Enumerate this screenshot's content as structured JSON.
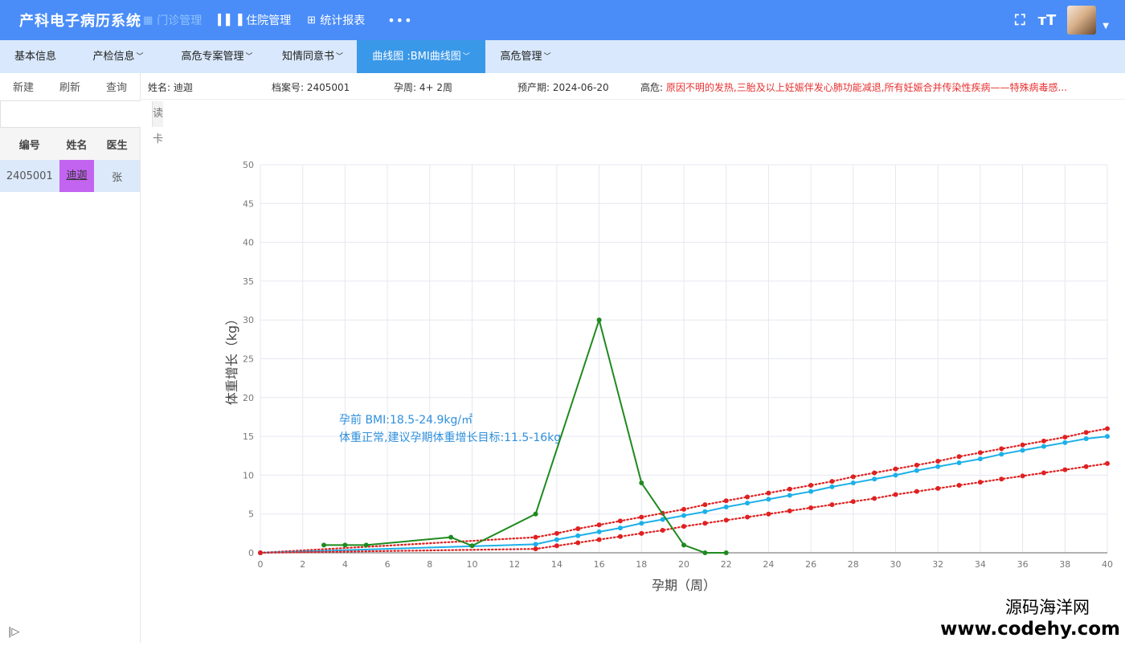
{
  "app": {
    "title": "产科电子病历系统"
  },
  "topnav": {
    "items": [
      {
        "label": "门诊管理",
        "icon": "grid-icon",
        "active": true
      },
      {
        "label": "住院管理",
        "icon": "bar-chart-icon",
        "active": false
      },
      {
        "label": "统计报表",
        "icon": "table-icon",
        "active": false
      }
    ],
    "more": "•••"
  },
  "toolbar": {
    "fullscreen_icon": "⛶",
    "fontsize_icon": "ᴛT"
  },
  "secnav": {
    "items": [
      {
        "label": "基本信息",
        "dropdown": false,
        "active": false
      },
      {
        "label": "产检信息",
        "dropdown": true,
        "active": false
      },
      {
        "label": "高危专案管理",
        "dropdown": true,
        "active": false
      },
      {
        "label": "知情同意书",
        "dropdown": true,
        "active": false
      },
      {
        "label": "曲线图 :BMI曲线图",
        "dropdown": true,
        "active": true
      },
      {
        "label": "高危管理",
        "dropdown": true,
        "active": false
      }
    ]
  },
  "sidebar": {
    "actions": [
      "新建",
      "刷新",
      "查询"
    ],
    "card_input": {
      "value": "",
      "placeholder": ""
    },
    "card_button": "读卡",
    "table": {
      "headers": [
        "编号",
        "姓名",
        "医生"
      ],
      "rows": [
        [
          "2405001",
          "迪迦",
          "张"
        ]
      ]
    }
  },
  "patient": {
    "name_label": "姓名:",
    "name": "迪迦",
    "record_label": "档案号:",
    "record": "2405001",
    "gest_label": "孕周:",
    "gest": "4+ 2周",
    "due_label": "预产期:",
    "due": "2024-06-20",
    "risk_label": "高危:",
    "risk": "原因不明的发热,三胎及以上妊娠伴发心肺功能减退,所有妊娠合并传染性疾病——特殊病毒感..."
  },
  "chart_data": {
    "type": "line",
    "xlabel": "孕期（周）",
    "ylabel": "体重增长（kg）",
    "xlim": [
      0,
      40
    ],
    "ylim": [
      0,
      50
    ],
    "xticks": [
      0,
      2,
      4,
      6,
      8,
      10,
      12,
      14,
      16,
      18,
      20,
      22,
      24,
      26,
      28,
      30,
      32,
      34,
      36,
      38,
      40
    ],
    "yticks": [
      0,
      5,
      10,
      15,
      20,
      25,
      30,
      35,
      40,
      45,
      50
    ],
    "grid": true,
    "annotation": [
      "孕前 BMI:18.5-24.9kg/㎡",
      "体重正常,建议孕期体重增长目标:11.5-16kg"
    ],
    "series": [
      {
        "color": "#e02020",
        "style": "dotted",
        "x": [
          0,
          13,
          14,
          15,
          16,
          17,
          18,
          19,
          20,
          21,
          22,
          23,
          24,
          25,
          26,
          27,
          28,
          29,
          30,
          31,
          32,
          33,
          34,
          35,
          36,
          37,
          38,
          39,
          40
        ],
        "y": [
          0,
          2,
          2.5,
          3.1,
          3.6,
          4.1,
          4.6,
          5.1,
          5.6,
          6.2,
          6.7,
          7.2,
          7.7,
          8.2,
          8.7,
          9.2,
          9.8,
          10.3,
          10.8,
          11.3,
          11.8,
          12.4,
          12.9,
          13.4,
          13.9,
          14.4,
          14.9,
          15.5,
          16
        ]
      },
      {
        "color": "#1cb0e8",
        "style": "solid",
        "x": [
          0,
          13,
          14,
          15,
          16,
          17,
          18,
          19,
          20,
          21,
          22,
          23,
          24,
          25,
          26,
          27,
          28,
          29,
          30,
          31,
          32,
          33,
          34,
          35,
          36,
          37,
          38,
          39,
          40
        ],
        "y": [
          0,
          1.1,
          1.7,
          2.2,
          2.7,
          3.2,
          3.8,
          4.3,
          4.8,
          5.3,
          5.9,
          6.4,
          6.9,
          7.4,
          7.9,
          8.5,
          9,
          9.5,
          10,
          10.6,
          11.1,
          11.6,
          12.1,
          12.7,
          13.2,
          13.7,
          14.2,
          14.7,
          15
        ]
      },
      {
        "color": "#e02020",
        "style": "dotted",
        "x": [
          0,
          13,
          14,
          15,
          16,
          17,
          18,
          19,
          20,
          21,
          22,
          23,
          24,
          25,
          26,
          27,
          28,
          29,
          30,
          31,
          32,
          33,
          34,
          35,
          36,
          37,
          38,
          39,
          40
        ],
        "y": [
          0,
          0.5,
          0.9,
          1.3,
          1.7,
          2.1,
          2.5,
          2.9,
          3.4,
          3.8,
          4.2,
          4.6,
          5,
          5.4,
          5.8,
          6.2,
          6.6,
          7,
          7.5,
          7.9,
          8.3,
          8.7,
          9.1,
          9.5,
          9.9,
          10.3,
          10.7,
          11.1,
          11.5
        ]
      },
      {
        "color": "#1f8a1f",
        "style": "solid",
        "x": [
          3,
          4,
          5,
          9,
          10,
          13,
          16,
          18,
          20,
          21,
          22
        ],
        "y": [
          1,
          1,
          1,
          2,
          0.9,
          5,
          30,
          9,
          1,
          0,
          0
        ]
      }
    ]
  },
  "watermark": {
    "line1": "源码海洋网",
    "line2": "www.codehy.com"
  }
}
